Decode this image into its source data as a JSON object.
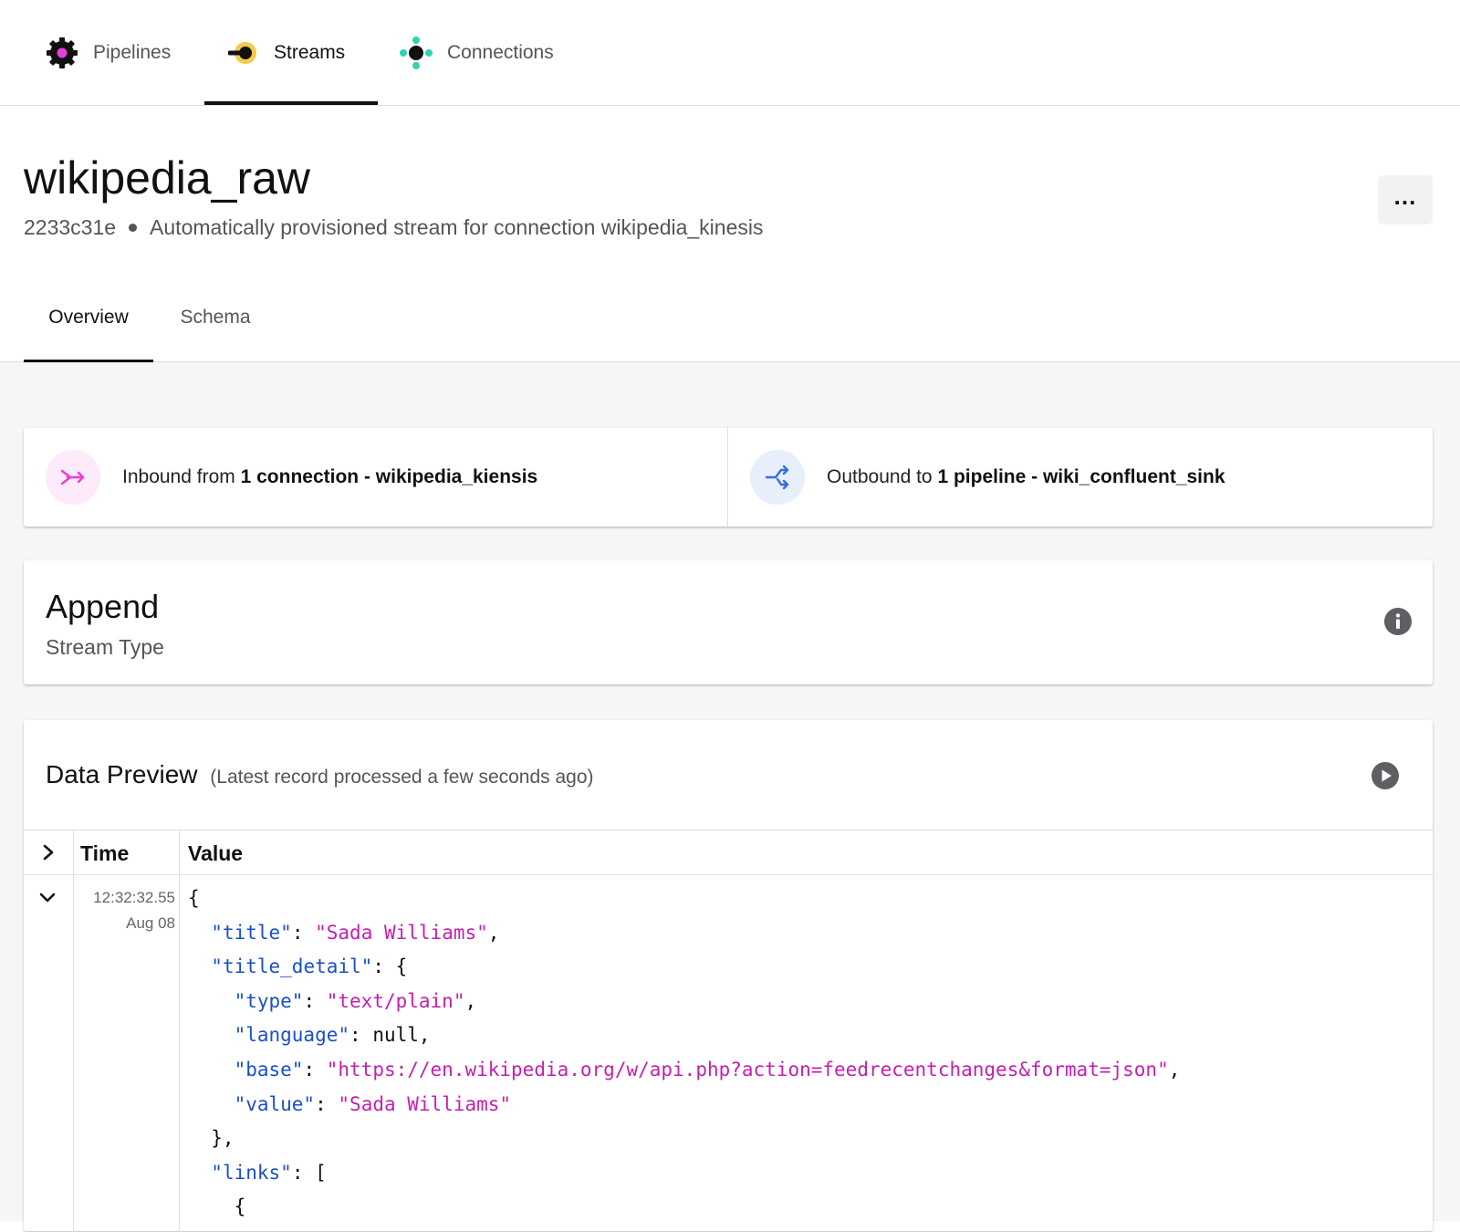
{
  "nav": {
    "tabs": [
      {
        "label": "Pipelines",
        "icon": "gear-icon"
      },
      {
        "label": "Streams",
        "icon": "stream-icon"
      },
      {
        "label": "Connections",
        "icon": "connections-icon"
      }
    ],
    "active": "Streams"
  },
  "header": {
    "title": "wikipedia_raw",
    "id": "2233c31e",
    "description": "Automatically provisioned stream for connection wikipedia_kinesis",
    "more_icon": "more-icon"
  },
  "tabs": [
    {
      "label": "Overview"
    },
    {
      "label": "Schema"
    }
  ],
  "active_tab": "Overview",
  "inbound": {
    "prefix": "Inbound from ",
    "count": "1 connection",
    "sep": " - ",
    "name": "wikipedia_kiensis",
    "icon": "inbound-icon"
  },
  "outbound": {
    "prefix": "Outbound to ",
    "count": "1 pipeline",
    "sep": " - ",
    "name": "wiki_confluent_sink",
    "icon": "outbound-icon"
  },
  "stream_type": {
    "value": "Append",
    "label": "Stream Type",
    "icon": "info-icon"
  },
  "preview": {
    "title": "Data Preview",
    "subtitle": "(Latest record processed a few seconds ago)",
    "play_icon": "play-icon",
    "columns": [
      "Time",
      "Value"
    ],
    "rows": [
      {
        "time": "12:32:32.55",
        "date": "Aug 08",
        "json": {
          "title": "Sada Williams",
          "type": "text/plain",
          "language": "null",
          "base": "https://en.wikipedia.org/w/api.php?action=feedrecentchanges&format=json",
          "value": "Sada Williams"
        }
      }
    ]
  },
  "colors": {
    "pink": "#e83fd6",
    "blue": "#2f6fe4",
    "teal": "#2fd3b2",
    "yellow": "#f7c948",
    "json_key": "#1a4fc9",
    "json_string": "#c51fae"
  }
}
